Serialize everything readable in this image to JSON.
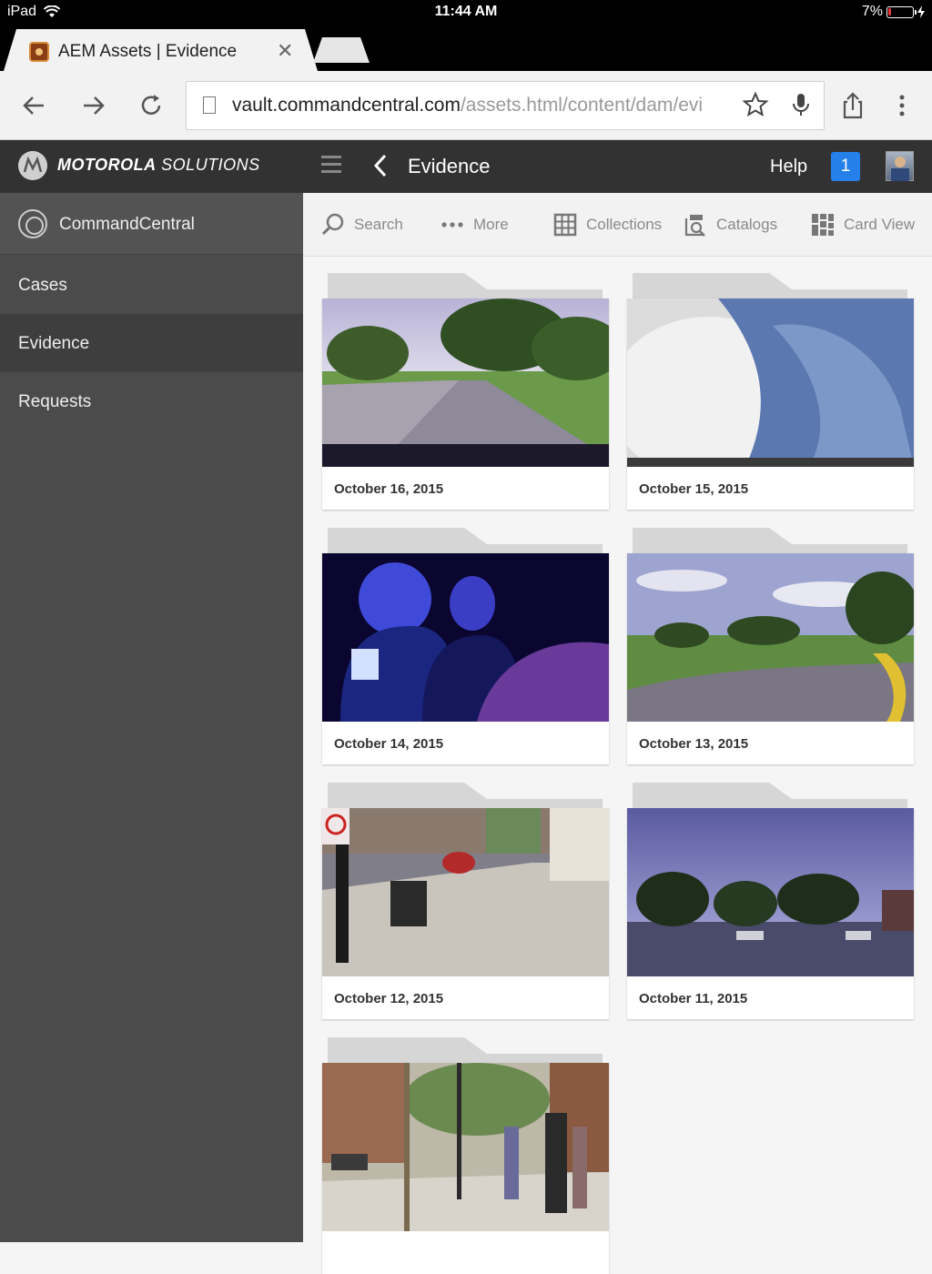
{
  "status_bar": {
    "device": "iPad",
    "time": "11:44 AM",
    "battery": "7%"
  },
  "browser": {
    "tab_title": "AEM Assets | Evidence",
    "url_host": "vault.commandcentral.com",
    "url_path": "/assets.html/content/dam/evi"
  },
  "header": {
    "brand_bold": "MOTOROLA",
    "brand_light": " SOLUTIONS",
    "title": "Evidence",
    "help_label": "Help",
    "notification_count": "1"
  },
  "sidebar": {
    "brand_label": "CommandCentral",
    "items": [
      {
        "label": "Cases"
      },
      {
        "label": "Evidence"
      },
      {
        "label": "Requests"
      }
    ]
  },
  "content_toolbar": {
    "search": "Search",
    "more": "More",
    "collections": "Collections",
    "catalogs": "Catalogs",
    "card_view": "Card View"
  },
  "cards": [
    {
      "date": "October 16, 2015"
    },
    {
      "date": "October 15, 2015"
    },
    {
      "date": "October 14, 2015"
    },
    {
      "date": "October 13, 2015"
    },
    {
      "date": "October 12, 2015"
    },
    {
      "date": "October 11, 2015"
    },
    {
      "date": ""
    }
  ],
  "colors": {
    "accent": "#2680eb",
    "header_bg": "#323232",
    "sidebar_bg": "#4b4b4b"
  }
}
